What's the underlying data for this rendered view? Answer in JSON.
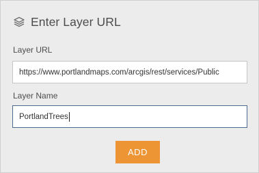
{
  "header": {
    "icon": "layers-icon",
    "title": "Enter Layer URL"
  },
  "layer_url": {
    "label": "Layer URL",
    "value": "https://www.portlandmaps.com/arcgis/rest/services/Public"
  },
  "layer_name": {
    "label": "Layer Name",
    "value": "PortlandTrees"
  },
  "add_button": {
    "label": "ADD",
    "color": "#ed9534"
  }
}
